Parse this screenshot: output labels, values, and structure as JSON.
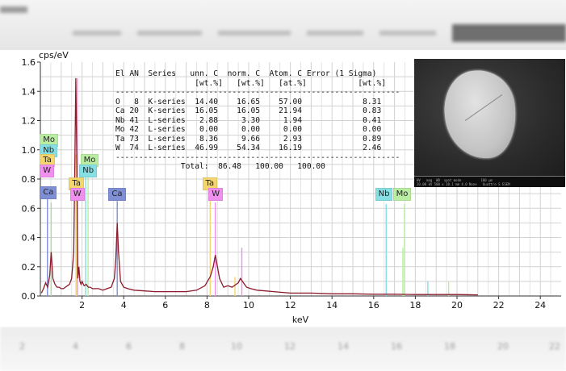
{
  "colors": {
    "spectrum": "#8b1a2b",
    "O": "#a6e0a6",
    "Ca": "#7f8fd6",
    "Nb": "#86dfe3",
    "Mo": "#b9eea2",
    "Ta": "#f4d66e",
    "W": "#ef90ef"
  },
  "chart_data": {
    "type": "line",
    "title": "",
    "xlabel": "keV",
    "ylabel": "cps/eV",
    "xlim": [
      0,
      25
    ],
    "ylim": [
      0,
      1.6
    ],
    "x_ticks": [
      2,
      4,
      6,
      8,
      10,
      12,
      14,
      16,
      18,
      20,
      22,
      24
    ],
    "y_ticks": [
      0.0,
      0.2,
      0.4,
      0.6,
      0.8,
      1.0,
      1.2,
      1.4,
      1.6
    ],
    "grid": true,
    "series": [
      {
        "x": [
          0.05,
          0.15,
          0.25,
          0.35,
          0.45,
          0.52,
          0.6,
          0.7,
          0.8,
          0.9,
          1.0,
          1.1,
          1.2,
          1.3,
          1.4,
          1.5,
          1.6,
          1.65,
          1.7,
          1.75,
          1.78,
          1.8,
          1.85,
          1.9,
          1.95,
          2.0,
          2.1,
          2.2,
          2.3,
          2.4,
          2.5,
          2.6,
          2.8,
          3.0,
          3.2,
          3.4,
          3.55,
          3.62,
          3.69,
          3.75,
          3.85,
          4.0,
          4.2,
          4.5,
          5.0,
          5.5,
          6.0,
          6.5,
          7.0,
          7.5,
          7.9,
          8.1,
          8.15,
          8.3,
          8.4,
          8.6,
          8.8,
          9.0,
          9.2,
          9.4,
          9.5,
          9.6,
          9.7,
          9.9,
          10.1,
          10.4,
          10.8,
          11.2,
          11.6,
          12.0,
          13.0,
          14.0,
          15.0,
          16.0,
          17.0,
          18.0,
          19.0,
          20.0,
          21.0
        ],
        "y": [
          0.02,
          0.05,
          0.09,
          0.06,
          0.14,
          0.3,
          0.12,
          0.08,
          0.06,
          0.06,
          0.05,
          0.05,
          0.06,
          0.07,
          0.08,
          0.12,
          0.3,
          0.85,
          1.49,
          0.9,
          0.4,
          0.12,
          0.2,
          0.1,
          0.08,
          0.1,
          0.07,
          0.08,
          0.06,
          0.06,
          0.05,
          0.05,
          0.05,
          0.04,
          0.05,
          0.06,
          0.12,
          0.25,
          0.5,
          0.3,
          0.1,
          0.06,
          0.05,
          0.04,
          0.035,
          0.03,
          0.03,
          0.03,
          0.03,
          0.04,
          0.07,
          0.12,
          0.13,
          0.2,
          0.28,
          0.12,
          0.06,
          0.07,
          0.06,
          0.08,
          0.09,
          0.12,
          0.1,
          0.06,
          0.05,
          0.04,
          0.035,
          0.03,
          0.025,
          0.02,
          0.02,
          0.015,
          0.015,
          0.012,
          0.012,
          0.01,
          0.01,
          0.01,
          0.008
        ]
      }
    ],
    "lines": [
      {
        "el": "O",
        "x": 0.52,
        "y": 0.64
      },
      {
        "el": "Ca",
        "x": 0.34,
        "y": 0.72
      },
      {
        "el": "Nb",
        "x": 2.17,
        "y": 0.88
      },
      {
        "el": "Mo",
        "x": 2.29,
        "y": 0.97
      },
      {
        "el": "Ta",
        "x": 1.71,
        "y": 0.97
      },
      {
        "el": "W",
        "x": 1.775,
        "y": 1.49
      },
      {
        "el": "Ca",
        "x": 3.69,
        "y": 0.65
      },
      {
        "el": "Ta",
        "x": 8.15,
        "y": 0.66
      },
      {
        "el": "W",
        "x": 8.4,
        "y": 0.64
      },
      {
        "el": "W",
        "x": 9.67,
        "y": 0.33
      },
      {
        "el": "Ta",
        "x": 9.34,
        "y": 0.13
      },
      {
        "el": "Nb",
        "x": 16.6,
        "y": 0.63
      },
      {
        "el": "Mo",
        "x": 17.48,
        "y": 0.63
      },
      {
        "el": "Mo",
        "x": 17.4,
        "y": 0.33
      },
      {
        "el": "Nb",
        "x": 18.6,
        "y": 0.1
      },
      {
        "el": "Mo",
        "x": 19.6,
        "y": 0.1
      }
    ],
    "tags": [
      {
        "el": "Mo",
        "label": "Mo",
        "x": 0.05,
        "y": 1.07
      },
      {
        "el": "Nb",
        "label": "Nb",
        "x": 0.05,
        "y": 1.0
      },
      {
        "el": "Ta",
        "label": "Ta",
        "x": 0.05,
        "y": 0.93
      },
      {
        "el": "W",
        "label": "W",
        "x": 0.05,
        "y": 0.86
      },
      {
        "el": "Ca",
        "label": "Ca",
        "x": 0.05,
        "y": 0.71
      },
      {
        "el": "Mo",
        "label": "Mo",
        "x": 2.0,
        "y": 0.93
      },
      {
        "el": "Nb",
        "label": "Nb",
        "x": 1.95,
        "y": 0.86
      },
      {
        "el": "Ta",
        "label": "Ta",
        "x": 1.45,
        "y": 0.77
      },
      {
        "el": "W",
        "label": "W",
        "x": 1.5,
        "y": 0.7
      },
      {
        "el": "Ca",
        "label": "Ca",
        "x": 3.35,
        "y": 0.7
      },
      {
        "el": "Ta",
        "label": "Ta",
        "x": 7.85,
        "y": 0.77
      },
      {
        "el": "W",
        "label": "W",
        "x": 8.15,
        "y": 0.7
      },
      {
        "el": "Nb",
        "label": "Nb",
        "x": 16.15,
        "y": 0.7
      },
      {
        "el": "Mo",
        "label": "Mo",
        "x": 17.0,
        "y": 0.7
      }
    ]
  },
  "results": {
    "header": [
      "El AN  Series   unn. C  norm. C  Atom. C Error (1 Sigma)",
      "                 [wt.%]   [wt.%]   [at.%]           [wt.%]"
    ],
    "divider": "-------------------------------------------------------------",
    "rows": [
      "O   8  K-series  14.40    16.65    57.00             8.31",
      "Ca 20  K-series  16.05    16.05    21.94             0.83",
      "Nb 41  L-series   2.88     3.30     1.94             0.41",
      "Mo 42  L-series   0.00     0.00     0.00             0.00",
      "Ta 73  L-series   8.36     9.66     2.93             0.89",
      "W  74  L-series  46.99    54.34    16.19             2.46"
    ],
    "total": "              Total:  86.48   100.00   100.00"
  },
  "sem_info": "HV   mag  WD  spot mode          100 µm\n20.00 kV 500 x 10.1 mm 4.0 None   Quattro S ESEM",
  "background": {
    "bottom_ticks": [
      "2",
      "4",
      "6",
      "8",
      "10",
      "12",
      "14",
      "16",
      "18",
      "20",
      "22"
    ]
  }
}
